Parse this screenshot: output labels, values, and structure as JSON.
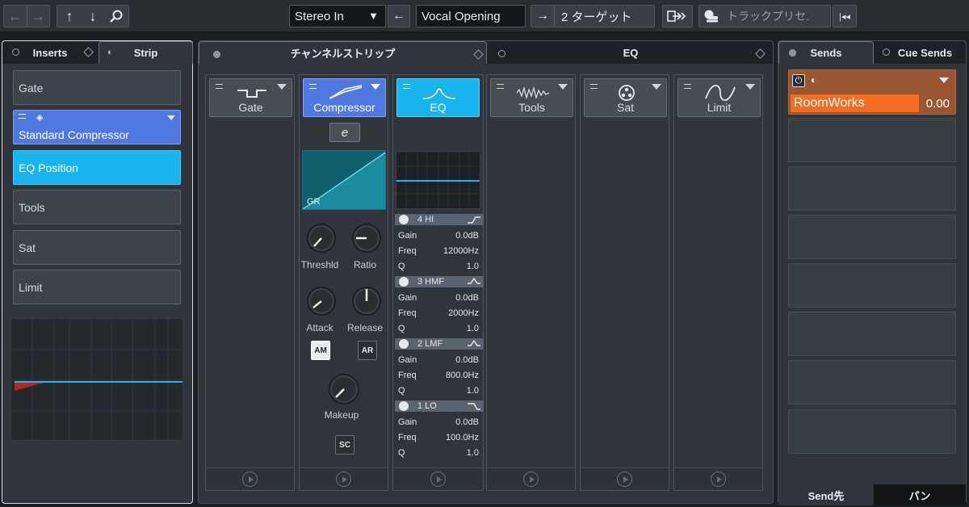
{
  "toolbar": {
    "input_routing": "Stereo In",
    "track_name": "Vocal Opening",
    "target": "2 ターゲット",
    "preset_placeholder": "トラックプリセ."
  },
  "left_panel": {
    "tabs": [
      {
        "label": "Inserts"
      },
      {
        "label": "Strip"
      }
    ],
    "items": [
      {
        "label": "Gate"
      },
      {
        "label": "Standard Compressor"
      },
      {
        "label": "EQ Position"
      },
      {
        "label": "Tools"
      },
      {
        "label": "Sat"
      },
      {
        "label": "Limit"
      }
    ]
  },
  "center_panel": {
    "tabs": [
      {
        "label": "チャンネルストリップ"
      },
      {
        "label": "EQ"
      }
    ],
    "modules": [
      {
        "label": "Gate"
      },
      {
        "label": "Compressor"
      },
      {
        "label": "EQ"
      },
      {
        "label": "Tools"
      },
      {
        "label": "Sat"
      },
      {
        "label": "Limit"
      }
    ],
    "compressor": {
      "graph_label": "GR",
      "knobs": [
        {
          "label": "Threshld"
        },
        {
          "label": "Ratio"
        },
        {
          "label": "Attack"
        },
        {
          "label": "Release"
        },
        {
          "label": "Makeup"
        }
      ],
      "am_label": "AM",
      "ar_label": "AR",
      "sc_label": "SC"
    },
    "eq": {
      "bands": [
        {
          "name": "4 HI",
          "params": [
            {
              "label": "Gain",
              "value": "0.0dB"
            },
            {
              "label": "Freq",
              "value": "12000Hz"
            },
            {
              "label": "Q",
              "value": "1.0"
            }
          ]
        },
        {
          "name": "3 HMF",
          "params": [
            {
              "label": "Gain",
              "value": "0.0dB"
            },
            {
              "label": "Freq",
              "value": "2000Hz"
            },
            {
              "label": "Q",
              "value": "1.0"
            }
          ]
        },
        {
          "name": "2 LMF",
          "params": [
            {
              "label": "Gain",
              "value": "0.0dB"
            },
            {
              "label": "Freq",
              "value": "800.0Hz"
            },
            {
              "label": "Q",
              "value": "1.0"
            }
          ]
        },
        {
          "name": "1 LO",
          "params": [
            {
              "label": "Gain",
              "value": "0.0dB"
            },
            {
              "label": "Freq",
              "value": "100.0Hz"
            },
            {
              "label": "Q",
              "value": "1.0"
            }
          ]
        }
      ]
    }
  },
  "right_panel": {
    "tabs": [
      {
        "label": "Sends"
      },
      {
        "label": "Cue Sends"
      }
    ],
    "send": {
      "name": "RoomWorks",
      "value": "0.00",
      "level": 0.78
    },
    "bottom_tabs": [
      {
        "label": "Send先"
      },
      {
        "label": "パン"
      }
    ]
  },
  "colors": {
    "compressor_blue": "#4f78e0",
    "eq_cyan": "#19b3ee",
    "send_orange": "#f26c24"
  }
}
